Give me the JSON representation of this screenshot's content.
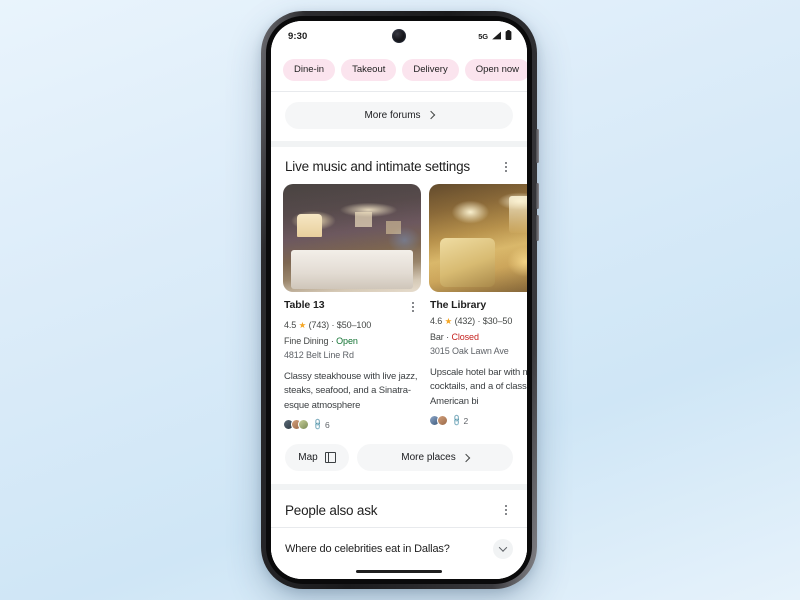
{
  "status_bar": {
    "time": "9:30",
    "network": "5G",
    "signal_icon": "signal-bars-icon",
    "battery_icon": "battery-icon",
    "camera_icon": "front-camera-punch-hole"
  },
  "filters": {
    "chips": [
      {
        "label": "Dine-in"
      },
      {
        "label": "Takeout"
      },
      {
        "label": "Delivery"
      },
      {
        "label": "Open now"
      }
    ]
  },
  "forums": {
    "more_label": "More forums",
    "chevron_icon": "chevron-right-icon"
  },
  "places_section": {
    "title": "Live music and intimate settings",
    "menu_icon": "kebab-menu-icon",
    "cards": [
      {
        "name": "Table 13",
        "rating": "4.5",
        "star_icon": "star-icon",
        "review_count": "(743)",
        "separator": "·",
        "price_range": "$50–100",
        "category": "Fine Dining",
        "status": "Open",
        "status_color": "#137333",
        "address": "4812 Belt Line Rd",
        "description": "Classy steakhouse with live jazz, steaks, seafood, and a Sinatra-esque atmosphere",
        "avatar_count": 3,
        "link_count": "6",
        "link_icon": "link-icon",
        "menu_icon": "kebab-menu-icon",
        "photo_alt": "restaurant-interior-photo"
      },
      {
        "name": "The Library",
        "rating": "4.6",
        "star_icon": "star-icon",
        "review_count": "(432)",
        "separator": "·",
        "price_range": "$30–50",
        "category": "Bar",
        "status": "Closed",
        "status_color": "#c5221f",
        "address": "3015 Oak Lawn Ave",
        "description": "Upscale hotel bar with music, cocktails, and a of classic American bi",
        "avatar_count": 2,
        "link_count": "2",
        "link_icon": "link-icon",
        "menu_icon": "kebab-menu-icon",
        "photo_alt": "hotel-bar-interior-photo"
      }
    ],
    "actions": {
      "map_label": "Map",
      "map_icon": "map-icon",
      "more_places_label": "More places",
      "chevron_icon": "chevron-right-icon"
    }
  },
  "people_also_ask": {
    "title": "People also ask",
    "menu_icon": "kebab-menu-icon",
    "questions": [
      {
        "text": "Where do celebrities eat in Dallas?",
        "expand_icon": "chevron-down-icon"
      }
    ]
  },
  "theme": {
    "chip_bg": "#fbe4ee",
    "pill_bg": "#f5f6f7",
    "background": "#dcecf9"
  }
}
